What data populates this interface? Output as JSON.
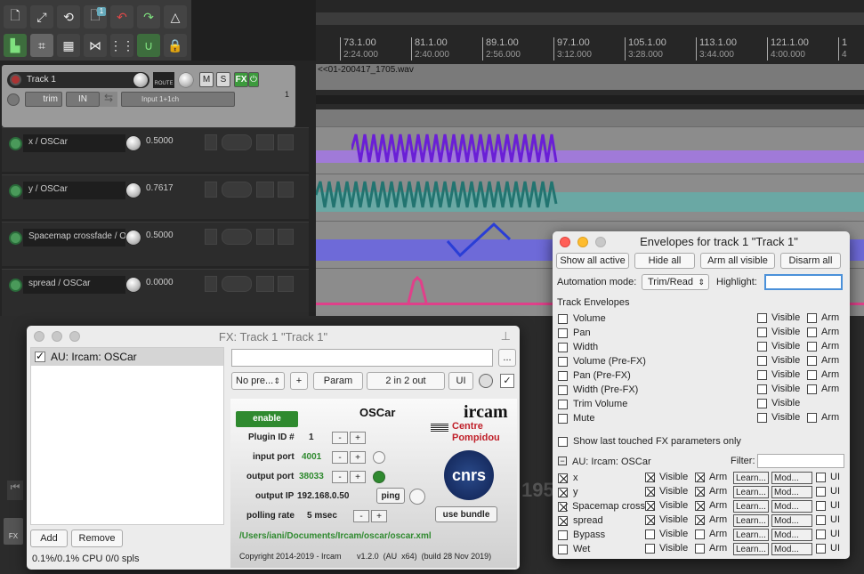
{
  "toolbar": {
    "icons": [
      "new-project-icon",
      "open-icon",
      "save-icon",
      "project-settings-icon",
      "undo-icon",
      "redo-icon",
      "metronome-icon",
      "ripple-edit-icon",
      "grid-snap-icon",
      "item-group-icon",
      "envelope-points-icon",
      "grid-lines-icon",
      "snap-magnet-icon",
      "lock-icon"
    ],
    "badge": "1"
  },
  "ruler": {
    "marks": [
      {
        "bar": "73.1.00",
        "time": "2:24.000"
      },
      {
        "bar": "81.1.00",
        "time": "2:40.000"
      },
      {
        "bar": "89.1.00",
        "time": "2:56.000"
      },
      {
        "bar": "97.1.00",
        "time": "3:12.000"
      },
      {
        "bar": "105.1.00",
        "time": "3:28.000"
      },
      {
        "bar": "113.1.00",
        "time": "3:44.000"
      },
      {
        "bar": "121.1.00",
        "time": "4:00.000"
      },
      {
        "bar": "1",
        "time": "4"
      }
    ]
  },
  "track": {
    "name": "Track 1",
    "route_label": "ROUTE",
    "mute_label": "M",
    "solo_label": "S",
    "fx_label": "FX",
    "trim_label": "trim",
    "in_label": "IN",
    "input_label": "Input 1+1ch",
    "number": "1",
    "item_name": "<<01-200417_1705.wav"
  },
  "envelope_lanes": [
    {
      "name": "x / OSCar",
      "value": "0.5000",
      "color": "#8a3de0"
    },
    {
      "name": "y / OSCar",
      "value": "0.7617",
      "color": "#2e8a86"
    },
    {
      "name": "Spacemap crossfade / O",
      "value": "0.5000",
      "color": "#3a5ad8"
    },
    {
      "name": "spread / OSCar",
      "value": "0.0000",
      "color": "#e0408a"
    }
  ],
  "fx_window": {
    "title": "FX: Track 1 \"Track 1\"",
    "plugin_entry": "AU: Ircam: OSCar",
    "preset": "No pre...",
    "plus_label": "+",
    "param_label": "Param",
    "io_label": "2 in 2 out",
    "ui_label": "UI",
    "more_label": "...",
    "add_label": "Add",
    "remove_label": "Remove",
    "cpu_status": "0.1%/0.1% CPU 0/0 spls"
  },
  "oscar": {
    "enable_label": "enable",
    "name": "OSCar",
    "ircam_logo": "ircam",
    "centre_logo": "Centre\nPompidou",
    "cnrs_logo": "cnrs",
    "plugin_id_label": "Plugin ID #",
    "plugin_id": "1",
    "input_port_label": "input port",
    "input_port": "4001",
    "output_port_label": "output port",
    "output_port": "38033",
    "output_ip_label": "output IP",
    "output_ip": "192.168.0.50",
    "ping_label": "ping",
    "polling_rate_label": "polling rate",
    "polling_rate": "5 msec",
    "use_bundle_label": "use bundle",
    "minus": "-",
    "plus": "+",
    "path": "/Users/iani/Documents/Ircam/oscar/oscar.xml",
    "copyright": "Copyright 2014-2019 - Ircam       v1.2.0  (AU  x64)  (build 28 Nov 2019)"
  },
  "env_window": {
    "title": "Envelopes for track 1 \"Track 1\"",
    "show_all_active": "Show all active",
    "hide_all": "Hide all",
    "arm_all_visible": "Arm all visible",
    "disarm_all": "Disarm all",
    "automation_mode_label": "Automation mode:",
    "automation_mode": "Trim/Read",
    "highlight_label": "Highlight:",
    "highlight_value": "",
    "track_envelopes_heading": "Track Envelopes",
    "visible_label": "Visible",
    "arm_label": "Arm",
    "track_envelopes": [
      {
        "name": "Volume",
        "arm": true
      },
      {
        "name": "Pan",
        "arm": true
      },
      {
        "name": "Width",
        "arm": true
      },
      {
        "name": "Volume (Pre-FX)",
        "arm": true
      },
      {
        "name": "Pan (Pre-FX)",
        "arm": true
      },
      {
        "name": "Width (Pre-FX)",
        "arm": true
      },
      {
        "name": "Trim Volume",
        "arm": false
      },
      {
        "name": "Mute",
        "arm": true
      }
    ],
    "show_last_touched": "Show last touched FX parameters only",
    "plugin_section": "AU: Ircam: OSCar",
    "filter_label": "Filter:",
    "learn_label": "Learn...",
    "mod_label": "Mod...",
    "ui_label": "UI",
    "fx_params": [
      {
        "name": "x",
        "checked": true,
        "visible": true,
        "arm": true
      },
      {
        "name": "y",
        "checked": true,
        "visible": true,
        "arm": true
      },
      {
        "name": "Spacemap cross",
        "checked": true,
        "visible": true,
        "arm": true
      },
      {
        "name": "spread",
        "checked": true,
        "visible": true,
        "arm": true
      },
      {
        "name": "Bypass",
        "checked": false,
        "visible": false,
        "arm": false
      },
      {
        "name": "Wet",
        "checked": false,
        "visible": false,
        "arm": false
      }
    ]
  },
  "bottom": {
    "fx_label": "FX",
    "partial_digits": "195"
  }
}
